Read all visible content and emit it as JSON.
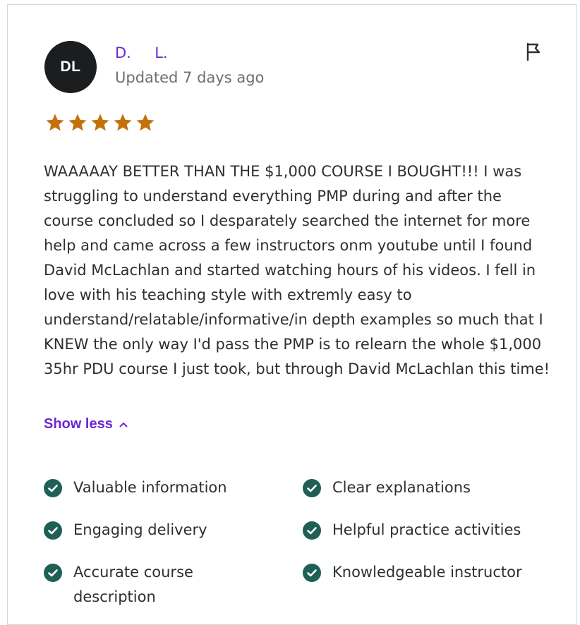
{
  "review": {
    "avatar_initials": "DL",
    "reviewer_name": "D.     L.",
    "updated": "Updated 7 days ago",
    "rating": 5,
    "text": "WAAAAAY BETTER THAN THE $1,000 COURSE I BOUGHT!!! I was struggling to understand everything PMP during and after the course concluded so I desparately searched the internet for more help and came across a few instructors onm youtube until I found David McLachlan and started watching hours of his videos. I fell in love with his teaching style with extremly easy to understand/relatable/informative/in depth examples so much that I KNEW the only way I'd pass the PMP is to relearn the whole $1,000 35hr PDU course I just took, but through David McLachlan this time!",
    "show_less_label": "Show less"
  },
  "tags": [
    {
      "label": "Valuable information"
    },
    {
      "label": "Clear explanations"
    },
    {
      "label": "Engaging delivery"
    },
    {
      "label": "Helpful practice activities"
    },
    {
      "label": "Accurate course description"
    },
    {
      "label": "Knowledgeable instructor"
    }
  ],
  "colors": {
    "accent": "#6d28d2",
    "star": "#c4710d",
    "check": "#1e6055",
    "avatar_bg": "#1c1d1f",
    "muted_text": "#6a6f73"
  },
  "icons": {
    "flag": "flag-icon",
    "star": "star-icon",
    "chevron": "chevron-up-icon",
    "check": "check-circle-icon"
  }
}
